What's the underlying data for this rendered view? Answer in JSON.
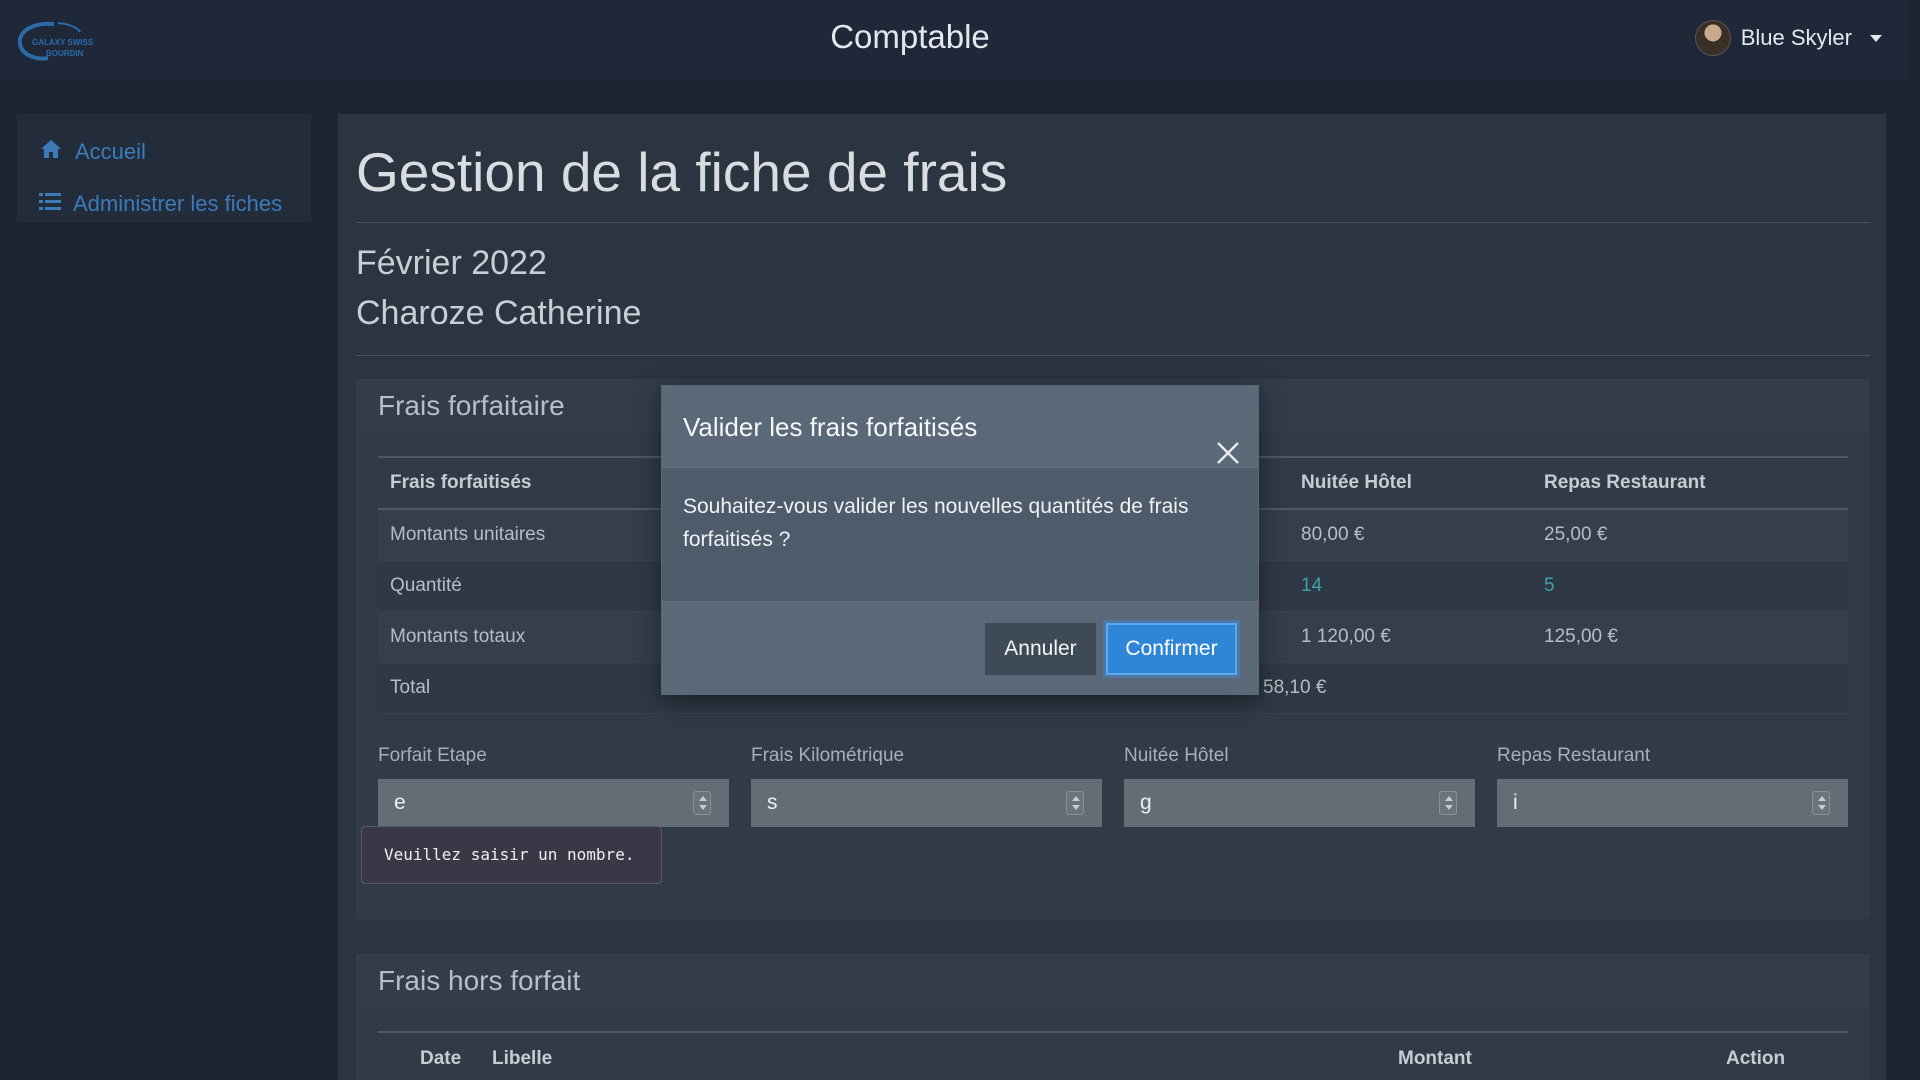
{
  "navbar": {
    "logo_text_1": "GALAXY SWISS",
    "logo_text_2": "BOURDIN",
    "title": "Comptable",
    "user_name": "Blue Skyler"
  },
  "sidebar": {
    "items": [
      {
        "label": "Accueil",
        "icon": "home-icon"
      },
      {
        "label": "Administrer les fiches",
        "icon": "list-icon"
      }
    ]
  },
  "main": {
    "page_title": "Gestion de la fiche de frais",
    "period": "Février 2022",
    "person": "Charoze Catherine",
    "forfait_card": {
      "title": "Frais forfaitaire",
      "table": {
        "headers": [
          "Frais forfaitisés",
          "",
          "",
          "Nuitée Hôtel",
          "Repas Restaurant"
        ],
        "rows": [
          {
            "label": "Montants unitaires",
            "cells": [
              "",
              "",
              "80,00 €",
              "25,00 €"
            ]
          },
          {
            "label": "Quantité",
            "cells": [
              "",
              "",
              "14",
              "5"
            ]
          },
          {
            "label": "Montants totaux",
            "cells": [
              "",
              "",
              "1 120,00 €",
              "125,00 €"
            ]
          },
          {
            "label": "Total",
            "total": "58,10 €"
          }
        ]
      },
      "inputs": [
        {
          "label": "Forfait Etape",
          "value": "e"
        },
        {
          "label": "Frais Kilométrique",
          "value": "s"
        },
        {
          "label": "Nuitée Hôtel",
          "value": "g"
        },
        {
          "label": "Repas Restaurant",
          "value": "i"
        }
      ],
      "validation_tooltip": "Veuillez saisir un nombre."
    },
    "hors_forfait_card": {
      "title": "Frais hors forfait",
      "headers": [
        "Date",
        "Libelle",
        "Montant",
        "Action"
      ]
    }
  },
  "modal": {
    "title": "Valider les frais forfaitisés",
    "body": "Souhaitez-vous valider les nouvelles quantités de frais forfaitisés ?",
    "cancel_label": "Annuler",
    "confirm_label": "Confirmer"
  },
  "colors": {
    "accent": "#2f86d6",
    "link": "#3d7bb8",
    "quantity": "#3ea1a8"
  }
}
